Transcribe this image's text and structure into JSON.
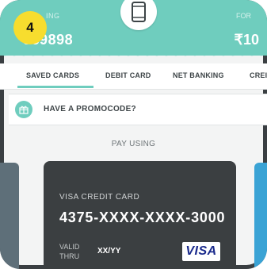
{
  "step_badge": "4",
  "header": {
    "recharge_label": "ING",
    "number": "989898",
    "for_label": "FOR",
    "amount": "₹10"
  },
  "tabs": [
    {
      "label": "SAVED CARDS",
      "active": true
    },
    {
      "label": "DEBIT CARD",
      "active": false
    },
    {
      "label": "NET BANKING",
      "active": false
    },
    {
      "label": "CREI",
      "active": false
    }
  ],
  "promo": {
    "label": "HAVE A PROMOCODE?",
    "icon": "gift-icon"
  },
  "pay_using": "PAY USING",
  "card": {
    "type": "VISA CREDIT CARD",
    "number": "4375-XXXX-XXXX-3000",
    "valid_thru_line1": "VALID",
    "valid_thru_line2": "THRU",
    "expiry": "XX/YY",
    "brand": "VISA"
  },
  "colors": {
    "accent": "#6fcdbe",
    "card_bg": "#3b3f41",
    "badge": "#f7dd2e",
    "visa_blue": "#1a2a8c"
  }
}
